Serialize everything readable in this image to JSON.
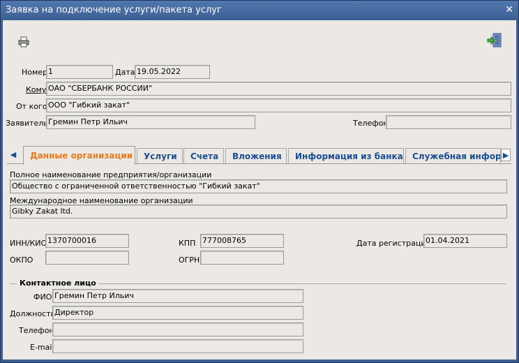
{
  "window": {
    "title": "Заявка на подключение услуги/пакета услуг"
  },
  "toolbar": {
    "print_icon": "printer-icon",
    "exit_icon": "exit-door-icon"
  },
  "header": {
    "number_label": "Номер",
    "number_value": "1",
    "date_label": "Дата",
    "date_value": "19.05.2022",
    "to_label": "Кому",
    "to_value": "ОАО \"СБЕРБАНК РОССИИ\"",
    "from_label": "От кого",
    "from_value": "ООО \"Гибкий закат\"",
    "applicant_label": "Заявитель",
    "applicant_value": "Гремин Петр Ильич",
    "phone_label": "Телефон",
    "phone_value": ""
  },
  "tabs": {
    "items": [
      {
        "label": "Данные организации"
      },
      {
        "label": "Услуги"
      },
      {
        "label": "Счета"
      },
      {
        "label": "Вложения"
      },
      {
        "label": "Информация из банка"
      },
      {
        "label": "Служебная информ"
      }
    ],
    "active_index": 0
  },
  "org": {
    "full_name_label": "Полное наименование предприятия/организации",
    "full_name_value": "Общество с ограниченной ответственностью \"Гибкий закат\"",
    "intl_name_label": "Международное наименование организации",
    "intl_name_value": "Gibky Zakat ltd.",
    "inn_label": "ИНН/КИО",
    "inn_value": "1370700016",
    "kpp_label": "КПП",
    "kpp_value": "777008765",
    "reg_date_label": "Дата регистрации",
    "reg_date_value": "01.04.2021",
    "okpo_label": "ОКПО",
    "okpo_value": "",
    "ogrn_label": "ОГРН",
    "ogrn_value": ""
  },
  "contact": {
    "group_title": "Контактное лицо",
    "fio_label": "ФИО",
    "fio_value": "Гремин Петр Ильич",
    "position_label": "Должность",
    "position_value": "Директор",
    "phone_label": "Телефон",
    "phone_value": "",
    "email_label": "E-mail",
    "email_value": ""
  },
  "colors": {
    "titlebar": "#3c5f93",
    "client_bg": "#ece9e4",
    "tab_text": "#1b4f93",
    "active_tab_text": "#e87a1e"
  }
}
